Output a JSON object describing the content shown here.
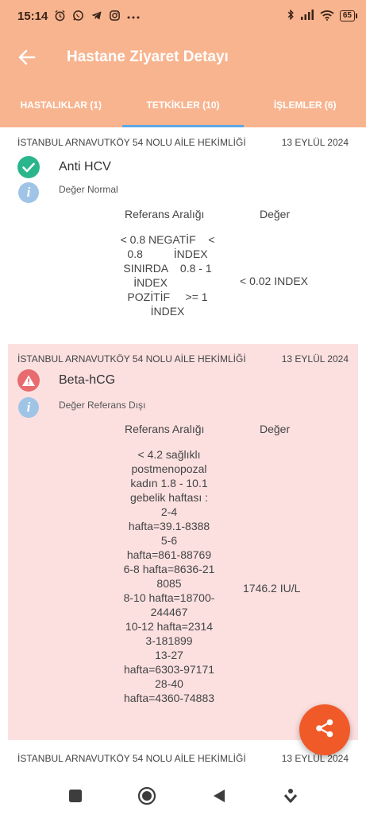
{
  "status_bar": {
    "time": "15:14",
    "icons_left": [
      "alarm-icon",
      "whatsapp-icon",
      "telegram-icon",
      "instagram-icon",
      "more-dots-icon"
    ],
    "icons_right": [
      "bluetooth-icon",
      "signal-icon",
      "wifi-icon",
      "battery-icon"
    ],
    "battery": "65"
  },
  "app_bar": {
    "title": "Hastane Ziyaret Detayı"
  },
  "tabs": [
    {
      "label": "HASTALIKLAR (1)",
      "active": false
    },
    {
      "label": "TETKİKLER (10)",
      "active": true
    },
    {
      "label": "İŞLEMLER (6)",
      "active": false
    }
  ],
  "results": [
    {
      "institution": "İSTANBUL ARNAVUTKÖY 54 NOLU AİLE HEKİMLİĞİ",
      "date": "13 EYLÜL 2024",
      "test_name": "Anti HCV",
      "status_icon": "check-icon",
      "status": "Değer Normal",
      "ref_header": "Referans Aralığı",
      "value_header": "Değer",
      "reference": "< 0.8 NEGATİF    <\n0.8          İNDEX\nSINIRDA    0.8 - 1\nİNDEX           \nPOZİTİF     >= 1\nİNDEX",
      "value": "< 0.02 INDEX"
    },
    {
      "institution": "İSTANBUL ARNAVUTKÖY 54 NOLU AİLE HEKİMLİĞİ",
      "date": "13 EYLÜL 2024",
      "test_name": "Beta-hCG",
      "status_icon": "warning-icon",
      "status": "Değer Referans Dışı",
      "ref_header": "Referans Aralığı",
      "value_header": "Değer",
      "reference": "< 4.2 sağlıklı\npostmenopozal\nkadın 1.8 - 10.1\ngebelik haftası :\n2-4\nhafta=39.1-8388\n5-6\nhafta=861-88769\n6-8 hafta=8636-21\n8085\n8-10 hafta=18700-\n244467\n10-12 hafta=2314\n3-181899\n13-27\nhafta=6303-97171\n28-40\nhafta=4360-74883",
      "value": "1746.2 IU/L"
    },
    {
      "institution": "İSTANBUL ARNAVUTKÖY 54 NOLU AİLE HEKİMLİĞİ",
      "date": "13 EYLÜL 2024"
    }
  ],
  "fab": {
    "icon": "share-icon"
  },
  "nav_bar": {
    "buttons": [
      "recent-apps-icon",
      "home-icon",
      "back-triangle-icon",
      "assistant-icon"
    ]
  },
  "colors": {
    "primary": "#f8b48f",
    "tab_indicator": "#5aa9e6",
    "normal": "#2bb58c",
    "warning": "#e86b6f",
    "warning_card_bg": "#fce0e0",
    "info": "#9fc4e6",
    "fab": "#f05a28"
  }
}
